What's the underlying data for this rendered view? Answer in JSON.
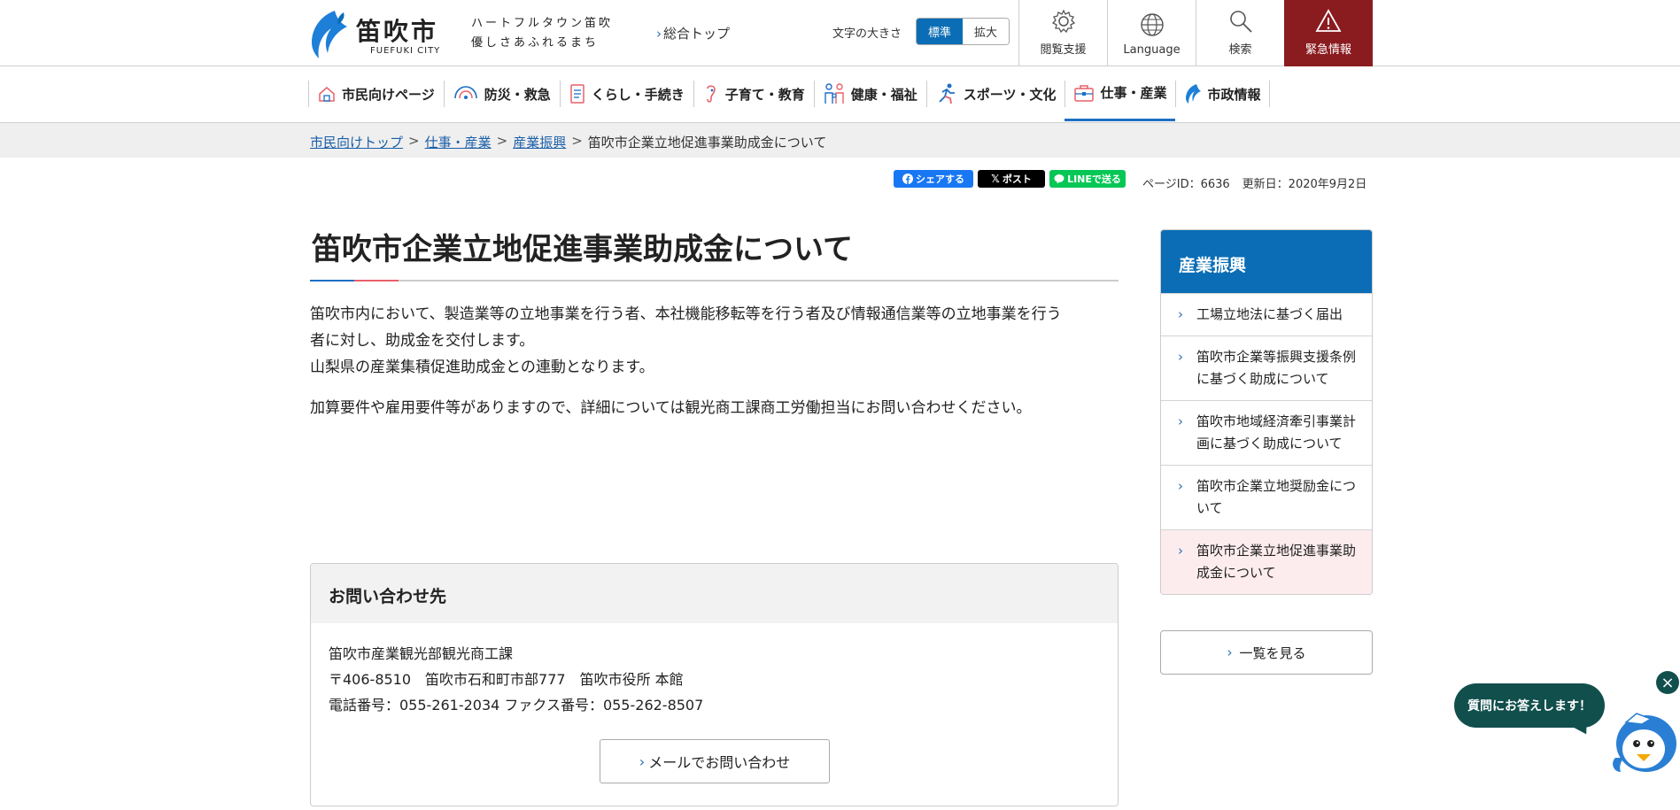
{
  "header": {
    "logo_name": "笛吹市",
    "logo_sub": "FUEFUKI CITY",
    "tagline_1": "ハートフルタウン笛吹",
    "tagline_2": "優しさあふれるまち",
    "top_link": "総合トップ",
    "font_size_label": "文字の大きさ",
    "font_size_standard": "標準",
    "font_size_large": "拡大",
    "browse_support": "閲覧支援",
    "language": "Language",
    "search": "検索",
    "emergency": "緊急情報"
  },
  "global_nav": [
    {
      "label": "市民向けページ",
      "icon": "home-icon"
    },
    {
      "label": "防災・救急",
      "icon": "disaster-icon"
    },
    {
      "label": "くらし・手続き",
      "icon": "document-icon"
    },
    {
      "label": "子育て・教育",
      "icon": "child-icon"
    },
    {
      "label": "健康・福祉",
      "icon": "family-icon"
    },
    {
      "label": "スポーツ・文化",
      "icon": "runner-icon"
    },
    {
      "label": "仕事・産業",
      "icon": "briefcase-icon"
    },
    {
      "label": "市政情報",
      "icon": "city-logo-icon"
    }
  ],
  "breadcrumb": {
    "items": [
      "市民向けトップ",
      "仕事・産業",
      "産業振興"
    ],
    "current": "笛吹市企業立地促進事業助成金について",
    "separator": ">"
  },
  "share": {
    "facebook": "シェアする",
    "x": "ポスト",
    "line": "LINEで送る"
  },
  "meta": {
    "page_id": "ページID：6636",
    "updated": "更新日：2020年9月2日"
  },
  "main": {
    "title": "笛吹市企業立地促進事業助成金について",
    "para1_line1": "笛吹市内において、製造業等の立地事業を行う者、本社機能移転等を行う者及び情報通信業等の立地事業を行う",
    "para1_line2": "者に対し、助成金を交付します。",
    "para1_line3": "山梨県の産業集積促進助成金との連動となります。",
    "para2": "加算要件や雇用要件等がありますので、詳細については観光商工課商工労働担当にお問い合わせください。"
  },
  "contact": {
    "heading": "お問い合わせ先",
    "dept": "笛吹市産業観光部観光商工課",
    "address": "〒406-8510　笛吹市石和町市部777　笛吹市役所 本館",
    "phone": "電話番号：055-261-2034 ファクス番号：055-262-8507",
    "mail_button": "メールでお問い合わせ"
  },
  "sidebar": {
    "heading": "産業振興",
    "items": [
      {
        "label": "工場立地法に基づく届出",
        "active": false
      },
      {
        "label": "笛吹市企業等振興支援条例に基づく助成について",
        "active": false
      },
      {
        "label": "笛吹市地域経済牽引事業計画に基づく助成について",
        "active": false
      },
      {
        "label": "笛吹市企業立地奨励金について",
        "active": false
      },
      {
        "label": "笛吹市企業立地促進事業助成金について",
        "active": true
      }
    ],
    "list_button": "一覧を見る"
  },
  "chat": {
    "bubble": "質問にお答えします！"
  },
  "colors": {
    "primary_blue": "#0a6db5",
    "emergency_red": "#8a1b1f",
    "chat_green": "#114f4d",
    "active_item_bg": "#fdecee"
  }
}
